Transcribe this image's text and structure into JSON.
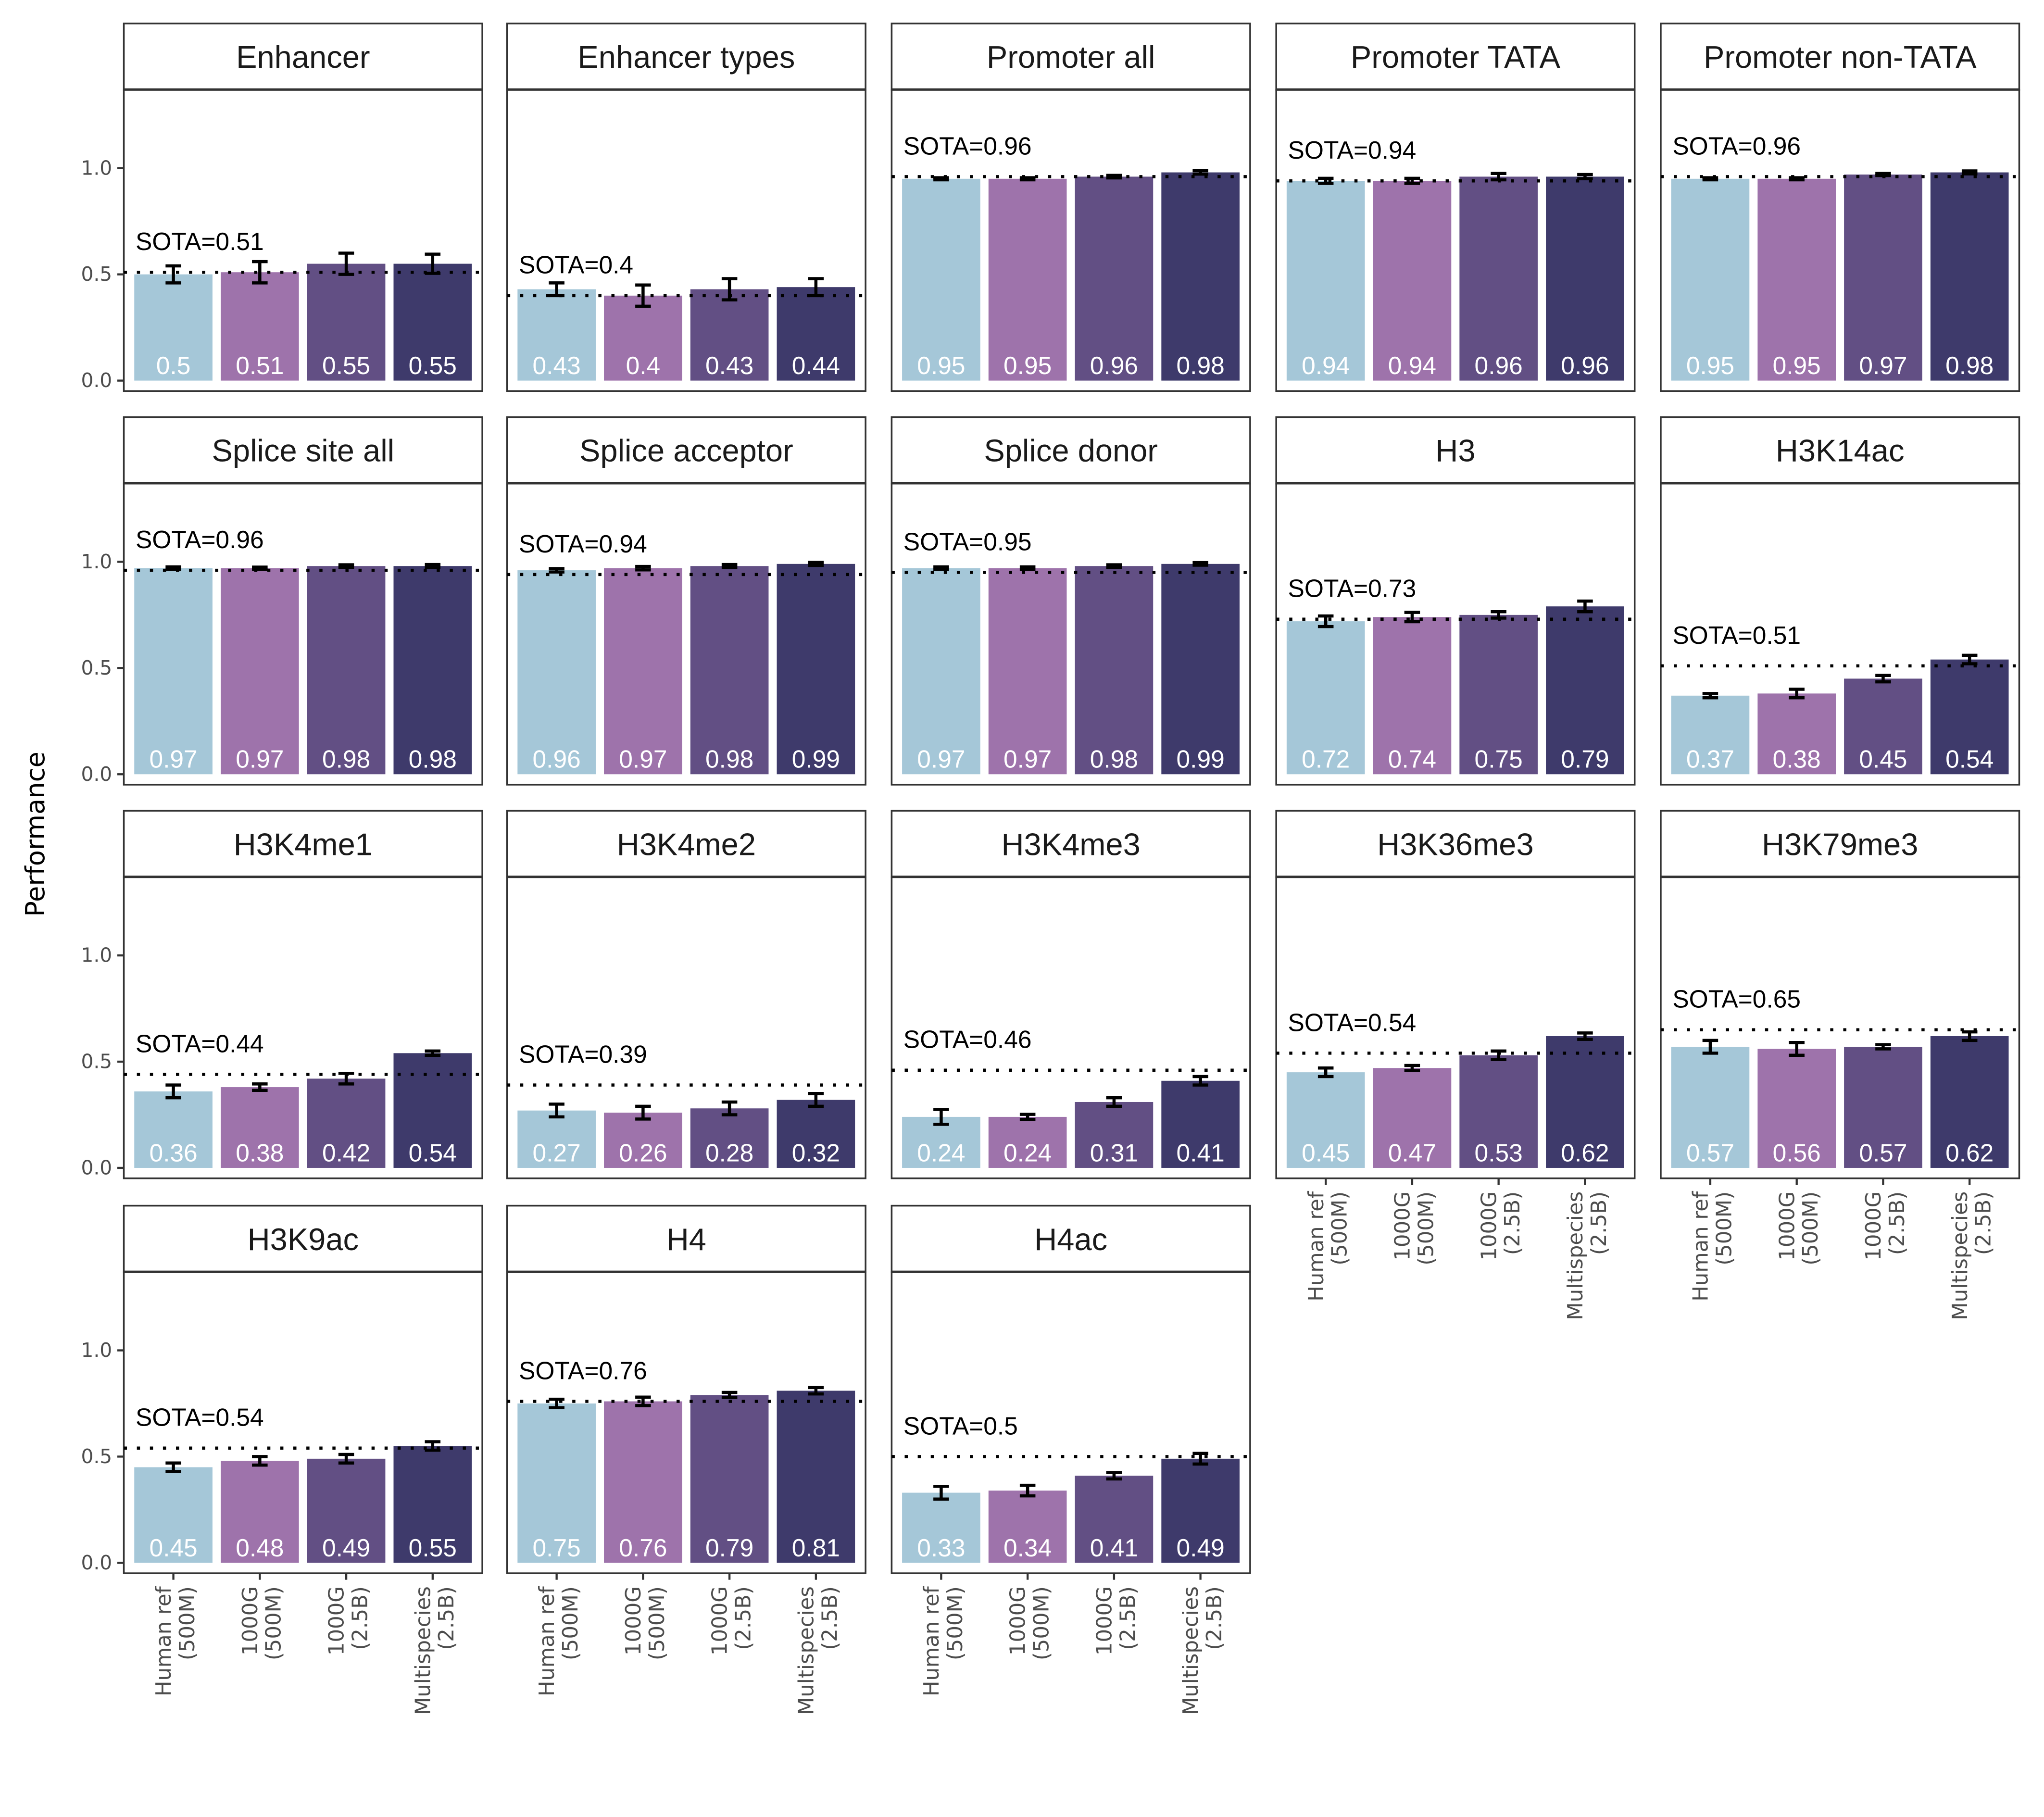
{
  "chart_data": {
    "type": "bar",
    "title": "",
    "ylabel": "Performance",
    "xlabel": "",
    "ylim": [
      0,
      1.35
    ],
    "yticks": [
      "0.0",
      "0.5",
      "1.0"
    ],
    "grid": false,
    "layout": "faceted 4 rows x 5 columns",
    "categories": [
      "Human ref (500M)",
      "1000G (500M)",
      "1000G (2.5B)",
      "Multispecies (2.5B)"
    ],
    "category_lines": [
      [
        "Human ref",
        "(500M)"
      ],
      [
        "1000G",
        "(500M)"
      ],
      [
        "1000G",
        "(2.5B)"
      ],
      [
        "Multispecies",
        "(2.5B)"
      ]
    ],
    "colors": [
      "#A5C7D8",
      "#9E73AB",
      "#624F84",
      "#3E3A6B"
    ],
    "panels": [
      {
        "title": "Enhancer",
        "sota": 0.51,
        "sota_label": "SOTA=0.51",
        "values": [
          0.5,
          0.51,
          0.55,
          0.55
        ],
        "labels": [
          "0.5",
          "0.51",
          "0.55",
          "0.55"
        ],
        "err": [
          0.04,
          0.05,
          0.05,
          0.045
        ]
      },
      {
        "title": "Enhancer types",
        "sota": 0.4,
        "sota_label": "SOTA=0.4",
        "values": [
          0.43,
          0.4,
          0.43,
          0.44
        ],
        "labels": [
          "0.43",
          "0.4",
          "0.43",
          "0.44"
        ],
        "err": [
          0.03,
          0.05,
          0.05,
          0.04
        ]
      },
      {
        "title": "Promoter all",
        "sota": 0.96,
        "sota_label": "SOTA=0.96",
        "values": [
          0.95,
          0.95,
          0.96,
          0.98
        ],
        "labels": [
          "0.95",
          "0.95",
          "0.96",
          "0.98"
        ],
        "err": [
          0.005,
          0.005,
          0.006,
          0.008
        ]
      },
      {
        "title": "Promoter TATA",
        "sota": 0.94,
        "sota_label": "SOTA=0.94",
        "values": [
          0.94,
          0.94,
          0.96,
          0.96
        ],
        "labels": [
          "0.94",
          "0.94",
          "0.96",
          "0.96"
        ],
        "err": [
          0.012,
          0.012,
          0.015,
          0.01
        ]
      },
      {
        "title": "Promoter non-TATA",
        "sota": 0.96,
        "sota_label": "SOTA=0.96",
        "values": [
          0.95,
          0.95,
          0.97,
          0.98
        ],
        "labels": [
          "0.95",
          "0.95",
          "0.97",
          "0.98"
        ],
        "err": [
          0.005,
          0.005,
          0.005,
          0.007
        ]
      },
      {
        "title": "Splice site all",
        "sota": 0.96,
        "sota_label": "SOTA=0.96",
        "values": [
          0.97,
          0.97,
          0.98,
          0.98
        ],
        "labels": [
          "0.97",
          "0.97",
          "0.98",
          "0.98"
        ],
        "err": [
          0.006,
          0.005,
          0.006,
          0.007
        ]
      },
      {
        "title": "Splice acceptor",
        "sota": 0.94,
        "sota_label": "SOTA=0.94",
        "values": [
          0.96,
          0.97,
          0.98,
          0.99
        ],
        "labels": [
          "0.96",
          "0.97",
          "0.98",
          "0.99"
        ],
        "err": [
          0.008,
          0.008,
          0.007,
          0.007
        ]
      },
      {
        "title": "Splice donor",
        "sota": 0.95,
        "sota_label": "SOTA=0.95",
        "values": [
          0.97,
          0.97,
          0.98,
          0.99
        ],
        "labels": [
          "0.97",
          "0.97",
          "0.98",
          "0.99"
        ],
        "err": [
          0.006,
          0.006,
          0.006,
          0.006
        ]
      },
      {
        "title": "H3",
        "sota": 0.73,
        "sota_label": "SOTA=0.73",
        "values": [
          0.72,
          0.74,
          0.75,
          0.79
        ],
        "labels": [
          "0.72",
          "0.74",
          "0.75",
          "0.79"
        ],
        "err": [
          0.025,
          0.022,
          0.015,
          0.025
        ]
      },
      {
        "title": "H3K14ac",
        "sota": 0.51,
        "sota_label": "SOTA=0.51",
        "values": [
          0.37,
          0.38,
          0.45,
          0.54
        ],
        "labels": [
          "0.37",
          "0.38",
          "0.45",
          "0.54"
        ],
        "err": [
          0.01,
          0.02,
          0.015,
          0.02
        ]
      },
      {
        "title": "H3K4me1",
        "sota": 0.44,
        "sota_label": "SOTA=0.44",
        "values": [
          0.36,
          0.38,
          0.42,
          0.54
        ],
        "labels": [
          "0.36",
          "0.38",
          "0.42",
          "0.54"
        ],
        "err": [
          0.03,
          0.015,
          0.025,
          0.01
        ]
      },
      {
        "title": "H3K4me2",
        "sota": 0.39,
        "sota_label": "SOTA=0.39",
        "values": [
          0.27,
          0.26,
          0.28,
          0.32
        ],
        "labels": [
          "0.27",
          "0.26",
          "0.28",
          "0.32"
        ],
        "err": [
          0.03,
          0.03,
          0.03,
          0.03
        ]
      },
      {
        "title": "H3K4me3",
        "sota": 0.46,
        "sota_label": "SOTA=0.46",
        "values": [
          0.24,
          0.24,
          0.31,
          0.41
        ],
        "labels": [
          "0.24",
          "0.24",
          "0.31",
          "0.41"
        ],
        "err": [
          0.035,
          0.012,
          0.02,
          0.02
        ]
      },
      {
        "title": "H3K36me3",
        "sota": 0.54,
        "sota_label": "SOTA=0.54",
        "values": [
          0.45,
          0.47,
          0.53,
          0.62
        ],
        "labels": [
          "0.45",
          "0.47",
          "0.53",
          "0.62"
        ],
        "err": [
          0.02,
          0.012,
          0.02,
          0.015
        ]
      },
      {
        "title": "H3K79me3",
        "sota": 0.65,
        "sota_label": "SOTA=0.65",
        "values": [
          0.57,
          0.56,
          0.57,
          0.62
        ],
        "labels": [
          "0.57",
          "0.56",
          "0.57",
          "0.62"
        ],
        "err": [
          0.03,
          0.03,
          0.01,
          0.02
        ]
      },
      {
        "title": "H3K9ac",
        "sota": 0.54,
        "sota_label": "SOTA=0.54",
        "values": [
          0.45,
          0.48,
          0.49,
          0.55
        ],
        "labels": [
          "0.45",
          "0.48",
          "0.49",
          "0.55"
        ],
        "err": [
          0.02,
          0.02,
          0.02,
          0.02
        ]
      },
      {
        "title": "H4",
        "sota": 0.76,
        "sota_label": "SOTA=0.76",
        "values": [
          0.75,
          0.76,
          0.79,
          0.81
        ],
        "labels": [
          "0.75",
          "0.76",
          "0.79",
          "0.81"
        ],
        "err": [
          0.02,
          0.02,
          0.012,
          0.015
        ]
      },
      {
        "title": "H4ac",
        "sota": 0.5,
        "sota_label": "SOTA=0.5",
        "values": [
          0.33,
          0.34,
          0.41,
          0.49
        ],
        "labels": [
          "0.33",
          "0.34",
          "0.41",
          "0.49"
        ],
        "err": [
          0.03,
          0.025,
          0.015,
          0.025
        ]
      }
    ]
  }
}
